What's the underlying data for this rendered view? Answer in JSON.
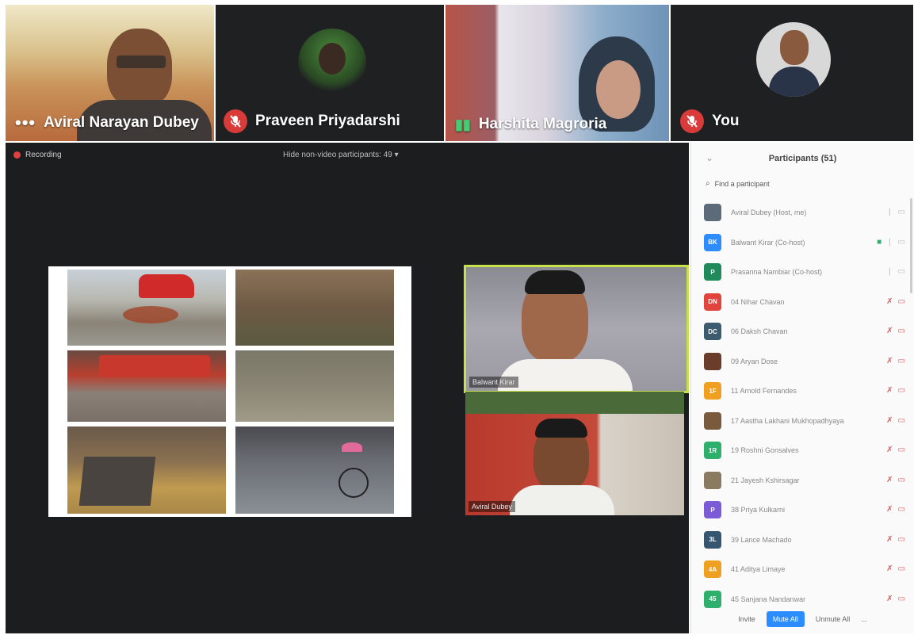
{
  "top_tiles": [
    {
      "name": "Aviral Narayan Dubey",
      "status": "dots"
    },
    {
      "name": "Praveen Priyadarshi",
      "status": "muted"
    },
    {
      "name": "Harshita Magroria",
      "status": "speaking"
    },
    {
      "name": "You",
      "status": "muted"
    }
  ],
  "main": {
    "recording_label": "Recording",
    "nonvideo_label": "Hide non-video participants: 49 ▾",
    "video1_label": "Balwant Kirar",
    "video2_label": "Aviral Dubey"
  },
  "participants": {
    "title": "Participants (51)",
    "search_placeholder": "Find a participant",
    "rows": [
      {
        "name": "Aviral Dubey (Host, me)",
        "initials": "",
        "color": "#5b6b7a"
      },
      {
        "name": "Balwant Kirar (Co-host)",
        "initials": "BK",
        "color": "#2d8cff"
      },
      {
        "name": "Prasanna Nambiar (Co-host)",
        "initials": "P",
        "color": "#1f8a5a"
      },
      {
        "name": "04 Nihar Chavan",
        "initials": "DN",
        "color": "#e0443c"
      },
      {
        "name": "06 Daksh Chavan",
        "initials": "DC",
        "color": "#3c5b6e"
      },
      {
        "name": "09 Aryan Dose",
        "initials": "",
        "color": "#6a3c2a"
      },
      {
        "name": "11 Arnold Fernandes",
        "initials": "1F",
        "color": "#f0a020"
      },
      {
        "name": "17 Aastha Lakhani Mukhopadhyaya",
        "initials": "",
        "color": "#7a5a3c"
      },
      {
        "name": "19 Roshni Gonsalves",
        "initials": "1R",
        "color": "#2eb06c"
      },
      {
        "name": "21 Jayesh Kshirsagar",
        "initials": "",
        "color": "#8a7a60"
      },
      {
        "name": "38 Priya Kulkarni",
        "initials": "P",
        "color": "#7c5cd6"
      },
      {
        "name": "39 Lance Machado",
        "initials": "3L",
        "color": "#35566e"
      },
      {
        "name": "41 Aditya Limaye",
        "initials": "4A",
        "color": "#f0a020"
      },
      {
        "name": "45 Sanjana Nandanwar",
        "initials": "45",
        "color": "#2eb06c"
      }
    ],
    "footer": {
      "invite": "Invite",
      "mute_all": "Mute All",
      "unmute_all": "Unmute All",
      "more": "..."
    }
  },
  "colors": {
    "muted_red": "#d93b3b",
    "accent_blue": "#2d8cff",
    "active_speaker_border": "#c8e04a"
  }
}
